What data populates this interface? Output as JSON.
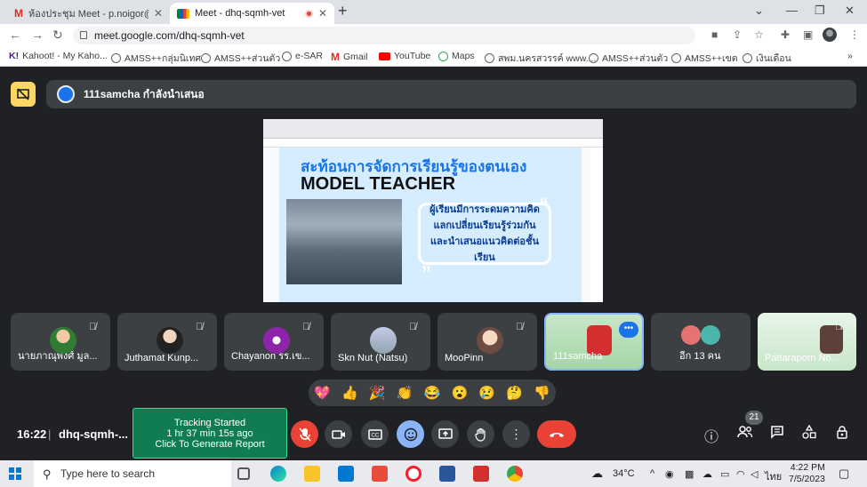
{
  "tabs": [
    {
      "label": "ห้องประชุม Meet - p.noigor@gma"
    },
    {
      "label": "Meet - dhq-sqmh-vet"
    }
  ],
  "address": {
    "url": "meet.google.com/dhq-sqmh-vet"
  },
  "bookmarks": [
    {
      "label": "Kahoot! - My Kaho..."
    },
    {
      "label": "AMSS++กลุ่มนิเทศ"
    },
    {
      "label": "AMSS++ส่วนตัว"
    },
    {
      "label": "e-SAR"
    },
    {
      "label": "Gmail"
    },
    {
      "label": "YouTube"
    },
    {
      "label": "Maps"
    },
    {
      "label": "สพม.นครสวรรค์ www...."
    },
    {
      "label": "AMSS++ส่วนตัว"
    },
    {
      "label": "AMSS++เขต"
    },
    {
      "label": "เงินเดือน"
    }
  ],
  "presenter": {
    "text": "111samcha กำลังนำเสนอ"
  },
  "slide": {
    "title": "สะท้อนการจัดการเรียนรู้ของตนเอง",
    "subtitle": "MODEL TEACHER",
    "quote_lines": [
      "ผู้เรียนมีการระดมความคิด",
      "แลกเปลี่ยนเรียนรู้ร่วมกัน",
      "และนำเสนอแนวคิดต่อชั้นเรียน"
    ],
    "quote_open": "“",
    "quote_close": "„"
  },
  "participants": [
    {
      "name": "นายภาณุพงศ์ มูล..."
    },
    {
      "name": "Juthamat Kunp..."
    },
    {
      "name": "Chayanon รร.เข..."
    },
    {
      "name": "Skn Nut (Natsu)"
    },
    {
      "name": "MooPinn"
    },
    {
      "name": "111samcha",
      "dots": "•••"
    },
    {
      "name": "อีก 13 คน"
    },
    {
      "name": "Pattaraporn No..."
    }
  ],
  "reactions": [
    "💖",
    "👍",
    "🎉",
    "👏",
    "😂",
    "😮",
    "😢",
    "🤔",
    "👎"
  ],
  "meeting": {
    "time": "16:22",
    "separator": "|",
    "code": "dhq-sqmh-..."
  },
  "tracking": {
    "line1": "Tracking Started",
    "line2": "1 hr 37 min 15s ago",
    "line3": "Click To Generate Report"
  },
  "people_count": "21",
  "taskbar": {
    "search_placeholder": "Type here to search",
    "temperature": "34°C",
    "language": "ไทย",
    "time": "4:22 PM",
    "date": "7/5/2023"
  },
  "icons": {
    "window": [
      "chevron-down-icon",
      "minimize-icon",
      "restore-icon",
      "close-icon"
    ],
    "controls": [
      "mic-off-icon",
      "camera-icon",
      "captions-icon",
      "emoji-icon",
      "present-icon",
      "hand-icon",
      "more-icon",
      "end-call-icon"
    ]
  },
  "colors": {
    "accent": "#8ab4f8",
    "end_call": "#ea4335",
    "tracking_bg": "#107c52",
    "shield": "#fdd663"
  }
}
